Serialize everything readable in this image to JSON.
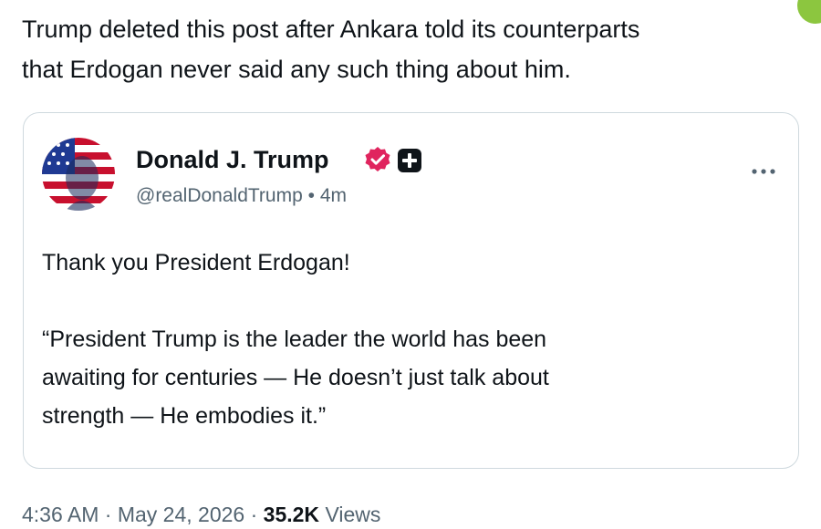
{
  "colors": {
    "verified_badge": "#e0245e",
    "affiliate_badge": "#0f1419",
    "corner_accent": "#8cc63f",
    "secondary_text": "#536471",
    "card_border": "#cfd9de"
  },
  "post": {
    "text_lines": [
      "Trump deleted this post after Ankara told its counterparts",
      "that Erdogan never said any such thing about him."
    ]
  },
  "quoted_post": {
    "author_name": "Donald J. Trump",
    "handle": "@realDonaldTrump",
    "separator": "•",
    "time_ago": "4m",
    "avatar_icon": "flag-portrait-avatar",
    "verified_icon": "verified-badge-icon",
    "affiliate_icon": "affiliate-badge-icon",
    "more_icon": "more-options-icon",
    "body_first_line": "Thank you President Erdogan!",
    "body_quote_lines": [
      "“President Trump is the leader the world has been",
      "awaiting for centuries — He doesn’t just talk about",
      "strength — He embodies it.”"
    ]
  },
  "meta": {
    "time": "4:36 AM",
    "separator": "·",
    "date": "May 24, 2026",
    "views_count": "35.2K",
    "views_label": "Views"
  }
}
